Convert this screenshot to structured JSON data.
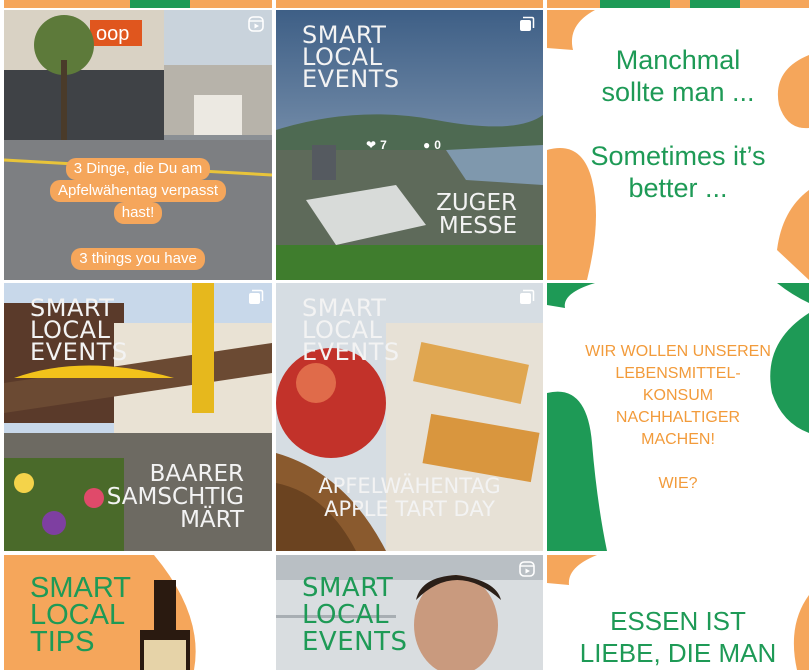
{
  "colors": {
    "green": "#1e9a56",
    "orange": "#f5a65b",
    "orange_text": "#f29b3b",
    "white": "#ffffff"
  },
  "posts": [
    {
      "type": "reel",
      "badge_icon": "reel-icon",
      "overlay_lines": [
        "3 Dinge, die Du am",
        "Apfelwähentag verpasst",
        "hast!"
      ],
      "overlay_lines_en": [
        "3 things you have"
      ],
      "sign_text": "oop"
    },
    {
      "type": "carousel",
      "badge_icon": "carousel-icon",
      "brand": [
        "SMART",
        "LOCAL",
        "EVENTS"
      ],
      "likes": "7",
      "comments": "0",
      "venue": [
        "ZUGER",
        "MESSE"
      ]
    },
    {
      "type": "graphic",
      "lines_de": [
        "Manchmal",
        "sollte man ..."
      ],
      "lines_en": [
        "Sometimes it’s",
        "better ..."
      ]
    },
    {
      "type": "carousel",
      "badge_icon": "carousel-icon",
      "brand": [
        "SMART",
        "LOCAL",
        "EVENTS"
      ],
      "event": [
        "BAARER",
        "SAMSCHTIG",
        "MÄRT"
      ]
    },
    {
      "type": "carousel",
      "badge_icon": "carousel-icon",
      "brand": [
        "SMART",
        "LOCAL",
        "EVENTS"
      ],
      "event": [
        "APFELWÄHENTAG",
        "APPLE TART DAY"
      ]
    },
    {
      "type": "graphic",
      "lines": [
        "WIR WOLLEN UNSEREN",
        "LEBENSMITTEL-",
        "KONSUM",
        "NACHHALTIGER",
        "MACHEN!",
        "",
        "WIE?"
      ]
    },
    {
      "type": "reel",
      "badge_icon": "reel-icon",
      "brand": [
        "SMART",
        "LOCAL",
        "TIPS"
      ]
    },
    {
      "type": "reel",
      "badge_icon": "reel-icon",
      "brand": [
        "SMART",
        "LOCAL",
        "EVENTS"
      ]
    },
    {
      "type": "graphic",
      "lines": [
        "ESSEN IST",
        "LIEBE, DIE MAN"
      ]
    }
  ]
}
